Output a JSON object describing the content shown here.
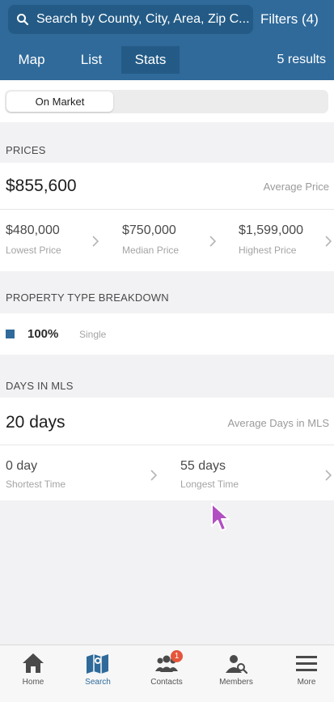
{
  "header": {
    "search_placeholder": "Search by County, City, Area, Zip C...",
    "filters_label": "Filters (4)",
    "tabs": [
      {
        "label": "Map"
      },
      {
        "label": "List"
      },
      {
        "label": "Stats"
      }
    ],
    "active_tab": "Stats",
    "results_label": "5 results"
  },
  "segment": {
    "active_label": "On Market"
  },
  "prices": {
    "heading": "PRICES",
    "average_value": "$855,600",
    "average_caption": "Average Price",
    "stats": [
      {
        "value": "$480,000",
        "caption": "Lowest Price"
      },
      {
        "value": "$750,000",
        "caption": "Median Price"
      },
      {
        "value": "$1,599,000",
        "caption": "Highest Price"
      }
    ]
  },
  "property_type": {
    "heading": "PROPERTY TYPE BREAKDOWN",
    "items": [
      {
        "percent": "100%",
        "type": "Single"
      }
    ],
    "swatch_color": "#2f6a9a"
  },
  "days_in_mls": {
    "heading": "DAYS IN MLS",
    "average_value": "20 days",
    "average_caption": "Average Days in MLS",
    "stats": [
      {
        "value": "0 day",
        "caption": "Shortest Time"
      },
      {
        "value": "55 days",
        "caption": "Longest Time"
      }
    ]
  },
  "tabbar": {
    "items": [
      {
        "label": "Home",
        "icon": "home-icon"
      },
      {
        "label": "Search",
        "icon": "map-search-icon"
      },
      {
        "label": "Contacts",
        "icon": "contacts-icon",
        "badge": "1"
      },
      {
        "label": "Members",
        "icon": "members-icon"
      },
      {
        "label": "More",
        "icon": "menu-icon"
      }
    ]
  },
  "colors": {
    "brand": "#2f6a9a",
    "brand_dark": "#245b86",
    "badge": "#e5553a"
  }
}
